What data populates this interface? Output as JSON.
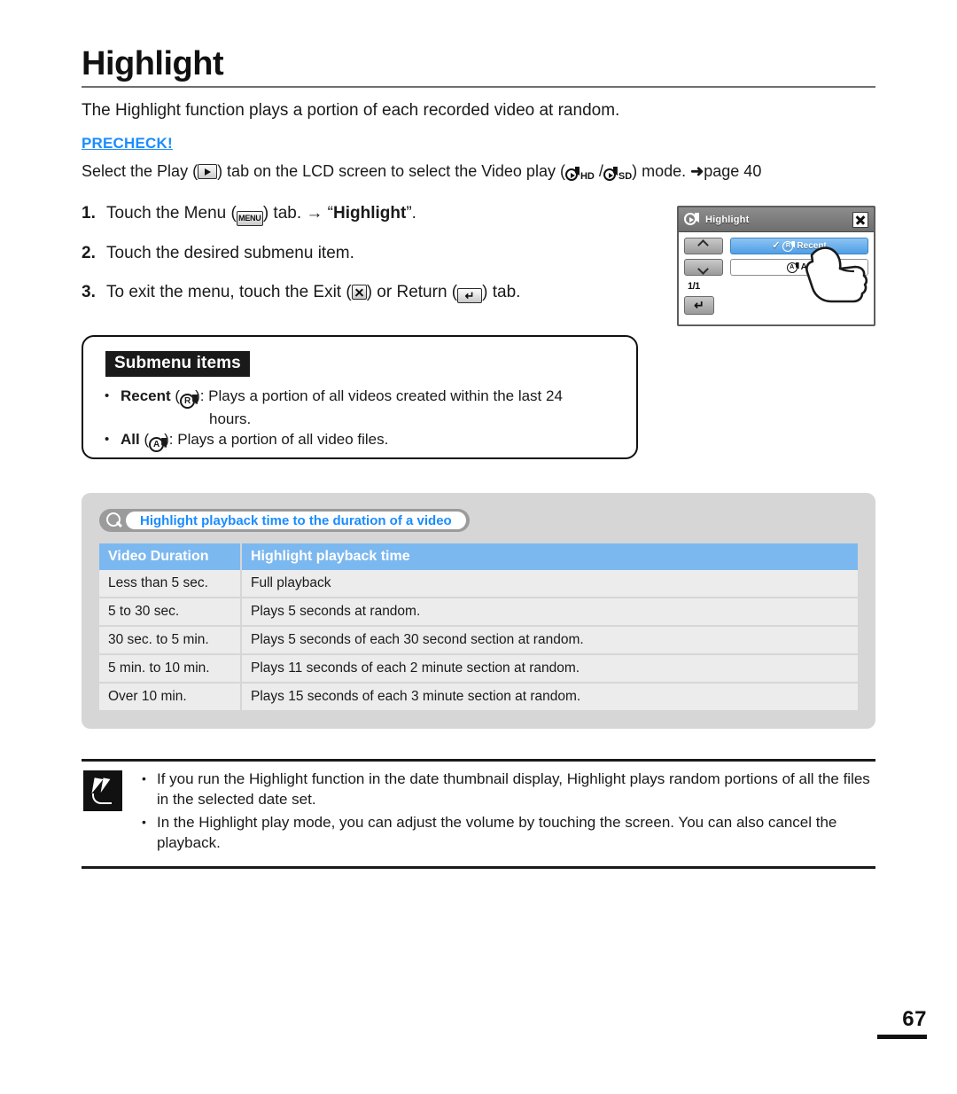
{
  "document": {
    "title": "Highlight",
    "intro": "The Highlight function plays a portion of each recorded video at random.",
    "page_number": "67"
  },
  "precheck": {
    "label": "PRECHECK!",
    "text_before": "Select the Play (",
    "play_icon": "play-icon",
    "text_middle": ") tab on the LCD screen to select the Video play (",
    "hd_label": "HD",
    "sd_label": "SD",
    "text_after": ") mode. ",
    "page_ref": "page 40",
    "arrow": "➜"
  },
  "steps": [
    {
      "num": "1.",
      "before": "Touch the Menu (",
      "icon": "menu-icon",
      "icon_label": "MENU",
      "after": ") tab. → “",
      "bold": "Highlight",
      "tail": "”."
    },
    {
      "num": "2.",
      "before": "Touch the desired submenu item.",
      "icon": "",
      "icon_label": "",
      "after": "",
      "bold": "",
      "tail": ""
    },
    {
      "num": "3.",
      "before": "To exit the menu, touch the Exit (",
      "icon": "exit-icon",
      "icon_label": "",
      "after": ") or Return (",
      "bold": "",
      "tail": ") tab."
    }
  ],
  "lcd": {
    "title": "Highlight",
    "header_icon": "video-play-icon",
    "close_icon": "close-icon",
    "scroll_up_icon": "chevron-up-icon",
    "scroll_down_icon": "chevron-down-icon",
    "page_indicator": "1/1",
    "return_icon": "return-arrow-icon",
    "items": [
      {
        "label": "Recent",
        "badge": "R",
        "selected": true,
        "check": "✓"
      },
      {
        "label": "All",
        "badge": "A",
        "selected": false,
        "check": ""
      }
    ],
    "colors": {
      "selected_start": "#8ec4f2",
      "selected_end": "#4f9fe6",
      "header_start": "#8d8d8d",
      "header_end": "#6e6e6e"
    }
  },
  "submenu": {
    "heading": "Submenu items",
    "items": [
      {
        "bullet": "•",
        "name": "Recent",
        "badge": "R",
        "desc_line1": "): Plays a portion of all videos created within the last 24",
        "desc_line2": "hours.",
        "open_paren": " ("
      },
      {
        "bullet": "•",
        "name": "All",
        "badge": "A",
        "desc_line1": "): Plays a portion of all video files.",
        "desc_line2": "",
        "open_paren": " ("
      }
    ]
  },
  "table_panel": {
    "search_label": "Highlight playback time to the duration of a video",
    "search_icon": "magnifier-icon",
    "columns": [
      "Video Duration",
      "Highlight playback time"
    ],
    "rows": [
      [
        "Less than 5 sec.",
        "Full playback"
      ],
      [
        "5 to 30 sec.",
        "Plays 5 seconds at random."
      ],
      [
        "30 sec. to 5 min.",
        "Plays 5 seconds of each 30 second section at random."
      ],
      [
        "5 min. to 10 min.",
        "Plays 11 seconds of each 2 minute section at random."
      ],
      [
        "Over 10 min.",
        "Plays 15 seconds of each 3 minute section at random."
      ]
    ],
    "colors": {
      "panel_bg": "#d6d6d6",
      "header_bg": "#7cb8f0",
      "cell_bg": "#ececec",
      "link_blue": "#1a8cff"
    }
  },
  "notes": {
    "icon": "note-pencil-icon",
    "items": [
      {
        "bullet": "•",
        "text": "If you run the Highlight function in the date thumbnail display, Highlight plays random portions of all the files in the selected date set."
      },
      {
        "bullet": "•",
        "text": "In the Highlight play mode, you can adjust the volume by touching the screen. You can also cancel the playback."
      }
    ]
  }
}
